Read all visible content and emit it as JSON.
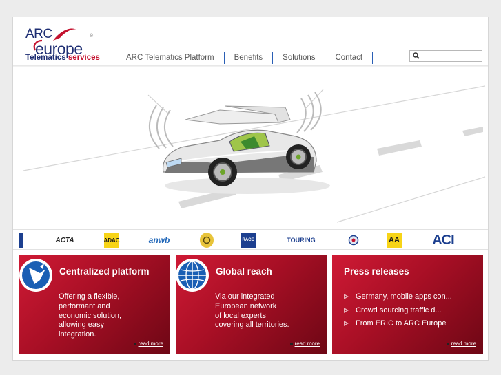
{
  "brand": {
    "logo_top": "ARC",
    "logo_bottom": "europe",
    "registered": "®",
    "tagline_main": "Telematics",
    "tagline_accent": "services"
  },
  "nav": {
    "items": [
      {
        "label": "ARC Telematics Platform"
      },
      {
        "label": "Benefits"
      },
      {
        "label": "Solutions"
      },
      {
        "label": "Contact"
      }
    ]
  },
  "search": {
    "placeholder": "",
    "value": "",
    "icon": "search-icon"
  },
  "hero": {
    "image": "concept-car-on-road",
    "icon": "car-illustration"
  },
  "clubs": {
    "logos": [
      {
        "label": "ACTA",
        "color": "#222222"
      },
      {
        "label": "ADAC",
        "color": "#1a1a1a",
        "bg": "#f7d417"
      },
      {
        "label": "anwb",
        "color": "#1f66b8"
      },
      {
        "label": "",
        "color": "#5a4a10",
        "bg": "#e8c43a"
      },
      {
        "label": "RACE",
        "color": "#ffffff",
        "bg": "#1c3f8f"
      },
      {
        "label": "TOURING",
        "color": "#1c3f8f"
      },
      {
        "label": "",
        "color": "#1c3f8f"
      },
      {
        "label": "AA",
        "color": "#1a1a1a",
        "bg": "#f7d417"
      },
      {
        "label": "ACI",
        "color": "#1c3f8f"
      }
    ]
  },
  "boxes": [
    {
      "title": "Centralized platform",
      "body": [
        "Offering a flexible,",
        "performant and",
        "economic solution,",
        "allowing easy",
        "integration."
      ],
      "read_more": "read more"
    },
    {
      "title": "Global reach",
      "body": [
        "Via our integrated",
        "European network",
        "of local experts",
        "covering all territories."
      ],
      "read_more": "read more"
    },
    {
      "title": "Press releases",
      "items": [
        "Germany, mobile apps con...",
        "Crowd sourcing traffic d...",
        "From ERIC to ARC Europe"
      ],
      "read_more": "read more"
    }
  ],
  "colors": {
    "brand_blue": "#1e2e73",
    "brand_red": "#c4122f",
    "box_red": "#a80f25",
    "nav_separator": "#2a5fb5"
  }
}
